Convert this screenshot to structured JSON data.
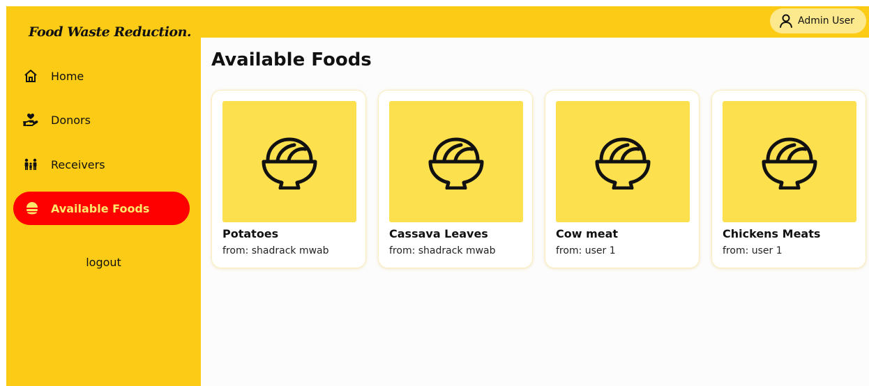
{
  "brand": "Food Waste Reduction.",
  "sidebar": {
    "items": [
      {
        "label": "Home",
        "icon": "home-icon"
      },
      {
        "label": "Donors",
        "icon": "donate-hand-heart-icon"
      },
      {
        "label": "Receivers",
        "icon": "people-icon"
      },
      {
        "label": "Available Foods",
        "icon": "food-icon",
        "active": true
      }
    ],
    "logout": "logout"
  },
  "header": {
    "user": "Admin User",
    "user_icon": "user-icon"
  },
  "main": {
    "title": "Available Foods",
    "foods": [
      {
        "name": "Potatoes",
        "from": "from: shadrack mwab",
        "icon": "bowl-icon"
      },
      {
        "name": "Cassava Leaves",
        "from": "from: shadrack mwab",
        "icon": "bowl-icon"
      },
      {
        "name": "Cow meat",
        "from": "from: user 1",
        "icon": "bowl-icon"
      },
      {
        "name": "Chickens Meats",
        "from": "from: user 1",
        "icon": "bowl-icon"
      }
    ]
  },
  "colors": {
    "sidebar": "#fccb16",
    "active": "#ff0000",
    "active_text": "#ffe86a",
    "thumb": "#fde04e",
    "chip": "#fde98d"
  }
}
